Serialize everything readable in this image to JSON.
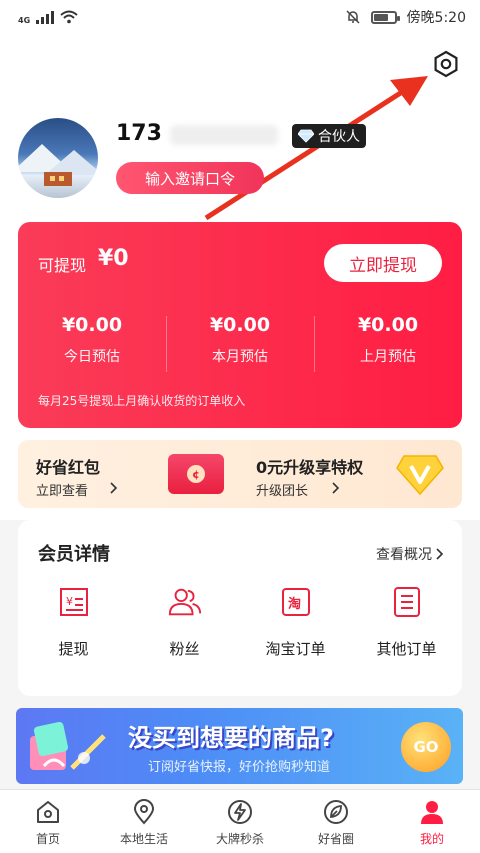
{
  "status_bar": {
    "network": "4G",
    "label": "傍晚5:20"
  },
  "profile": {
    "username": "173",
    "level": "合伙人",
    "invite_button": "输入邀请口令"
  },
  "earnings": {
    "withdraw_label": "可提现",
    "withdraw_amount": "¥0",
    "withdraw_button": "立即提现",
    "stats": [
      {
        "value": "¥0.00",
        "label": "今日预估"
      },
      {
        "value": "¥0.00",
        "label": "本月预估"
      },
      {
        "value": "¥0.00",
        "label": "上月预估"
      }
    ],
    "note": "每月25号提现上月确认收货的订单收入"
  },
  "promo": {
    "left_title": "好省红包",
    "left_sub": "立即查看",
    "right_title": "0元升级享特权",
    "right_sub": "升级团长"
  },
  "member": {
    "title": "会员详情",
    "overview": "查看概况",
    "items": [
      {
        "label": "提现",
        "icon": "withdraw-icon"
      },
      {
        "label": "粉丝",
        "icon": "fans-icon"
      },
      {
        "label": "淘宝订单",
        "icon": "taobao-order-icon"
      },
      {
        "label": "其他订单",
        "icon": "other-order-icon"
      }
    ]
  },
  "banner": {
    "title": "没买到想要的商品?",
    "subtitle": "订阅好省快报，好价抢购秒知道",
    "go": "GO"
  },
  "tabs": [
    {
      "label": "首页",
      "icon": "home-icon"
    },
    {
      "label": "本地生活",
      "icon": "location-icon"
    },
    {
      "label": "大牌秒杀",
      "icon": "lightning-icon"
    },
    {
      "label": "好省圈",
      "icon": "leaf-icon"
    },
    {
      "label": "我的",
      "icon": "profile-icon",
      "active": true
    }
  ],
  "colors": {
    "accent": "#ff1d43",
    "card_gradient_start": "#fa3c58",
    "annotation_arrow": "#e8321f"
  }
}
